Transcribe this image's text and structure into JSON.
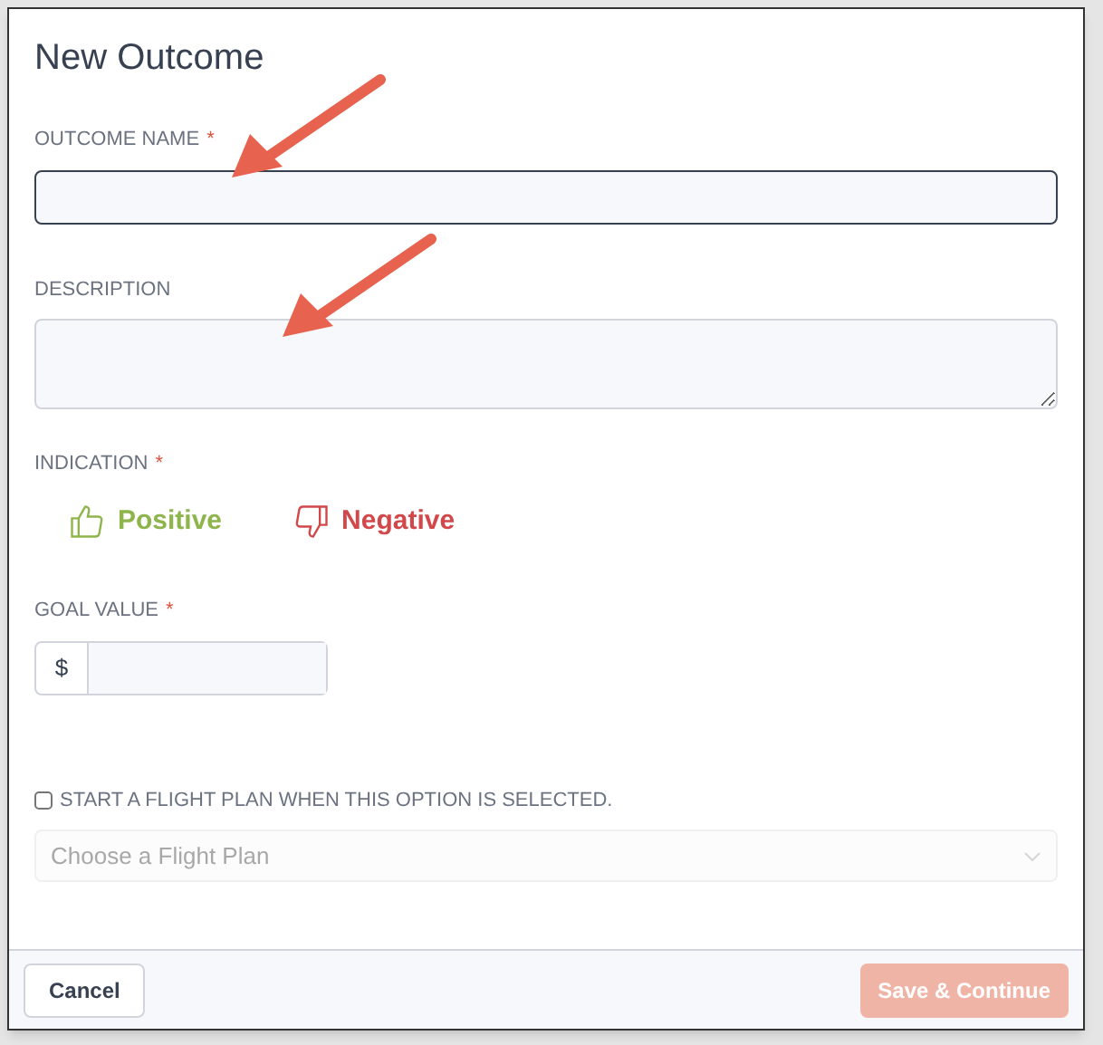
{
  "title": "New Outcome",
  "outcome_name": {
    "label": "OUTCOME NAME",
    "required_mark": "*"
  },
  "description": {
    "label": "DESCRIPTION"
  },
  "indication": {
    "label": "INDICATION",
    "required_mark": "*",
    "options": [
      {
        "label": "Positive",
        "kind": "positive"
      },
      {
        "label": "Negative",
        "kind": "negative"
      }
    ]
  },
  "goal_value": {
    "label": "GOAL VALUE",
    "required_mark": "*",
    "prefix": "$"
  },
  "flight_plan": {
    "label": "START A FLIGHT PLAN WHEN THIS OPTION IS SELECTED.",
    "checked": false,
    "select": {
      "placeholder": "Choose a Flight Plan",
      "disabled": true
    }
  },
  "buttons": {
    "cancel": "Cancel",
    "save": {
      "label": "Save & Continue",
      "disabled": true
    }
  }
}
